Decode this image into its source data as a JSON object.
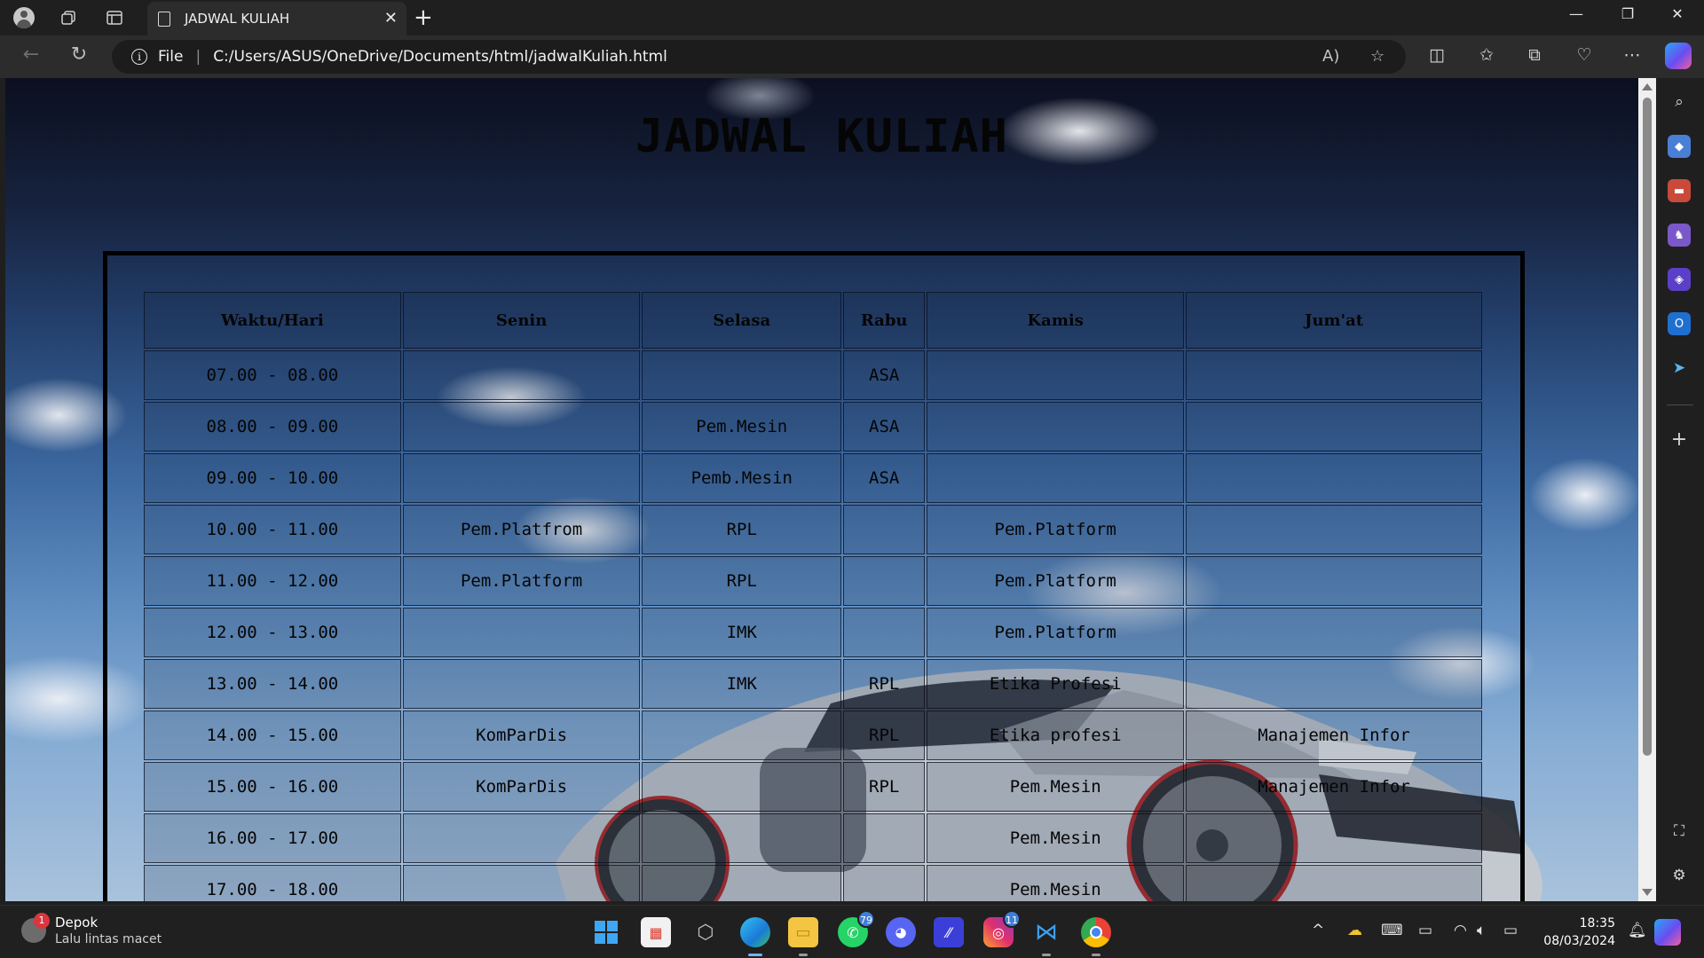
{
  "browser": {
    "tab_title": "JADWAL KULIAH",
    "address_scheme": "File",
    "address_url": "C:/Users/ASUS/OneDrive/Documents/html/jadwalKuliah.html"
  },
  "page": {
    "title": "JADWAL KULIAH",
    "headers": [
      "Waktu/Hari",
      "Senin",
      "Selasa",
      "Rabu",
      "Kamis",
      "Jum'at"
    ],
    "rows": [
      [
        "07.00 - 08.00",
        "",
        "",
        "ASA",
        "",
        ""
      ],
      [
        "08.00 - 09.00",
        "",
        "Pem.Mesin",
        "ASA",
        "",
        ""
      ],
      [
        "09.00 - 10.00",
        "",
        "Pemb.Mesin",
        "ASA",
        "",
        ""
      ],
      [
        "10.00 - 11.00",
        "Pem.Platfrom",
        "RPL",
        "",
        "Pem.Platform",
        ""
      ],
      [
        "11.00 - 12.00",
        "Pem.Platform",
        "RPL",
        "",
        "Pem.Platform",
        ""
      ],
      [
        "12.00 - 13.00",
        "",
        "IMK",
        "",
        "Pem.Platform",
        ""
      ],
      [
        "13.00 - 14.00",
        "",
        "IMK",
        "RPL",
        "Etika Profesi",
        ""
      ],
      [
        "14.00 - 15.00",
        "KomParDis",
        "",
        "RPL",
        "Etika profesi",
        "Manajemen Infor"
      ],
      [
        "15.00 - 16.00",
        "KomParDis",
        "",
        "RPL",
        "Pem.Mesin",
        "Manajemen Infor"
      ],
      [
        "16.00 - 17.00",
        "",
        "",
        "",
        "Pem.Mesin",
        ""
      ],
      [
        "17.00 - 18.00",
        "",
        "",
        "",
        "Pem.Mesin",
        ""
      ]
    ]
  },
  "taskbar": {
    "weather_location": "Depok",
    "weather_status": "Lalu lintas macet",
    "weather_badge": "1",
    "whatsapp_count": "79",
    "instagram_count": "11",
    "time": "18:35",
    "date": "08/03/2024"
  },
  "colors": {
    "chrome_bg": "#1f1f1f",
    "toolbar_bg": "#2c2c2c",
    "accent": "#3f7fd8"
  }
}
